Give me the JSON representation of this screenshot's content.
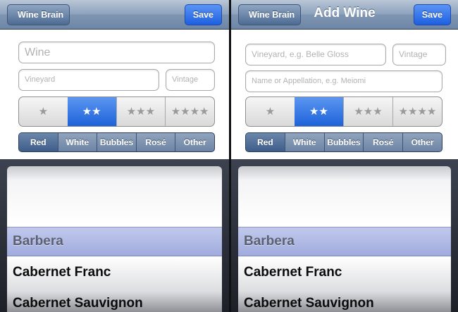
{
  "left_screen": {
    "nav": {
      "back_label": "Wine Brain",
      "save_label": "Save"
    },
    "form": {
      "wine_placeholder": "Wine",
      "vineyard_placeholder": "Vineyard",
      "vintage_placeholder": "Vintage"
    },
    "rating": {
      "options": [
        "★",
        "★★",
        "★★★",
        "★★★★"
      ],
      "selected_index": 1
    },
    "wine_types": {
      "options": [
        "Red",
        "White",
        "Bubbles",
        "Rosé",
        "Other"
      ],
      "selected_index": 0
    },
    "picker": {
      "rows": [
        "Barbera",
        "Cabernet Franc",
        "Cabernet Sauvignon"
      ],
      "selected_index": 0
    }
  },
  "right_screen": {
    "nav": {
      "back_label": "Wine Brain",
      "title": "Add Wine",
      "save_label": "Save"
    },
    "form": {
      "vineyard_placeholder": "Vineyard, e.g. Belle Gloss",
      "vintage_placeholder": "Vintage",
      "name_placeholder": "Name or Appellation, e.g. Meiomi"
    },
    "rating": {
      "options": [
        "★",
        "★★",
        "★★★",
        "★★★★"
      ],
      "selected_index": 1
    },
    "wine_types": {
      "options": [
        "Red",
        "White",
        "Bubbles",
        "Rosé",
        "Other"
      ],
      "selected_index": 0
    },
    "picker": {
      "rows": [
        "Barbera",
        "Cabernet Franc",
        "Cabernet Sauvignon"
      ],
      "selected_index": 0
    }
  },
  "colors": {
    "nav_tint": "#7e95b2",
    "accent_blue": "#1d62da",
    "segment_dark": "#3e5d89"
  }
}
